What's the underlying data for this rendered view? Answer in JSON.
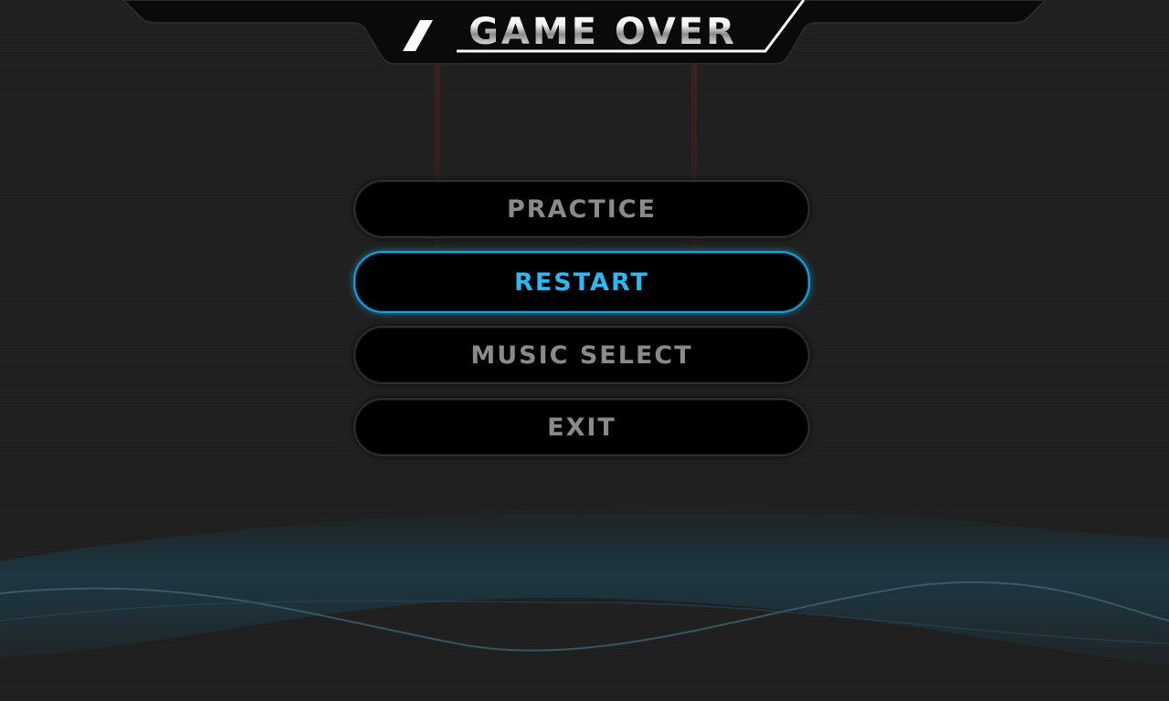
{
  "screen": {
    "title": "GAME OVER"
  },
  "menu": {
    "items": [
      {
        "label": "PRACTICE",
        "selected": false
      },
      {
        "label": "RESTART",
        "selected": true
      },
      {
        "label": "MUSIC SELECT",
        "selected": false
      },
      {
        "label": "EXIT",
        "selected": false
      }
    ]
  },
  "colors": {
    "background": "#1f1f1f",
    "button_fill": "#000000",
    "button_text": "#8a8a8a",
    "selected_accent": "#2cb8f0",
    "wave": "#1b4a5e"
  }
}
